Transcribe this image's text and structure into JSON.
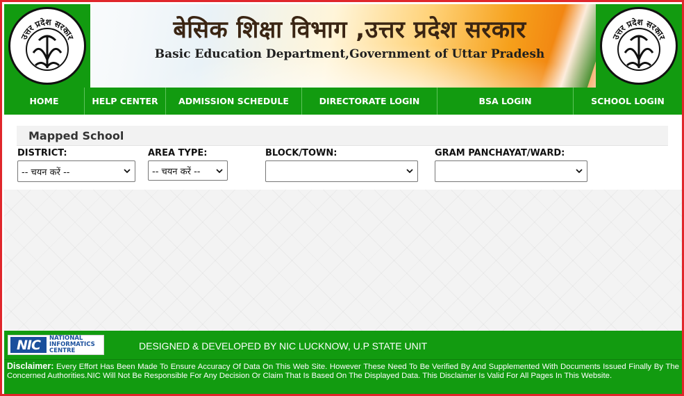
{
  "header": {
    "title_hindi": "बेसिक शिक्षा विभाग ,उत्तर प्रदेश सरकार",
    "title_english": "Basic Education Department,Government of Uttar Pradesh",
    "seal_text": "उत्तर प्रदेश सरकार"
  },
  "nav": {
    "items": [
      {
        "label": "HOME"
      },
      {
        "label": "HELP CENTER"
      },
      {
        "label": "ADMISSION SCHEDULE"
      },
      {
        "label": "DIRECTORATE LOGIN"
      },
      {
        "label": "BSA LOGIN"
      },
      {
        "label": "SCHOOL LOGIN"
      }
    ]
  },
  "panel": {
    "title": "Mapped School"
  },
  "filters": {
    "district": {
      "label": "DISTRICT:",
      "value": "-- चयन करें --"
    },
    "area_type": {
      "label": "AREA TYPE:",
      "value": "-- चयन करें --"
    },
    "block_town": {
      "label": "BLOCK/TOWN:",
      "value": ""
    },
    "gram_panchayat": {
      "label": "GRAM PANCHAYAT/WARD:",
      "value": ""
    }
  },
  "footer": {
    "nic_mark": "NIC",
    "nic_line1": "NATIONAL",
    "nic_line2": "INFORMATICS",
    "nic_line3": "CENTRE",
    "developed_by": "DESIGNED & DEVELOPED BY NIC LUCKNOW, U.P STATE UNIT",
    "disclaimer_label": "Disclaimer:",
    "disclaimer_text": " Every Effort Has Been Made To Ensure Accuracy Of Data On This Web Site. However These Need To Be Verified By And Supplemented With Documents Issued Finally By The Concerned Authorities.NIC Will Not Be Responsible For Any Decision Or Claim That Is Based On The Displayed Data. This Disclaimer Is Valid For All Pages In This Website."
  },
  "colors": {
    "brand_green": "#129b10",
    "frame_red": "#e0262b",
    "nic_blue": "#1a4f9c"
  }
}
